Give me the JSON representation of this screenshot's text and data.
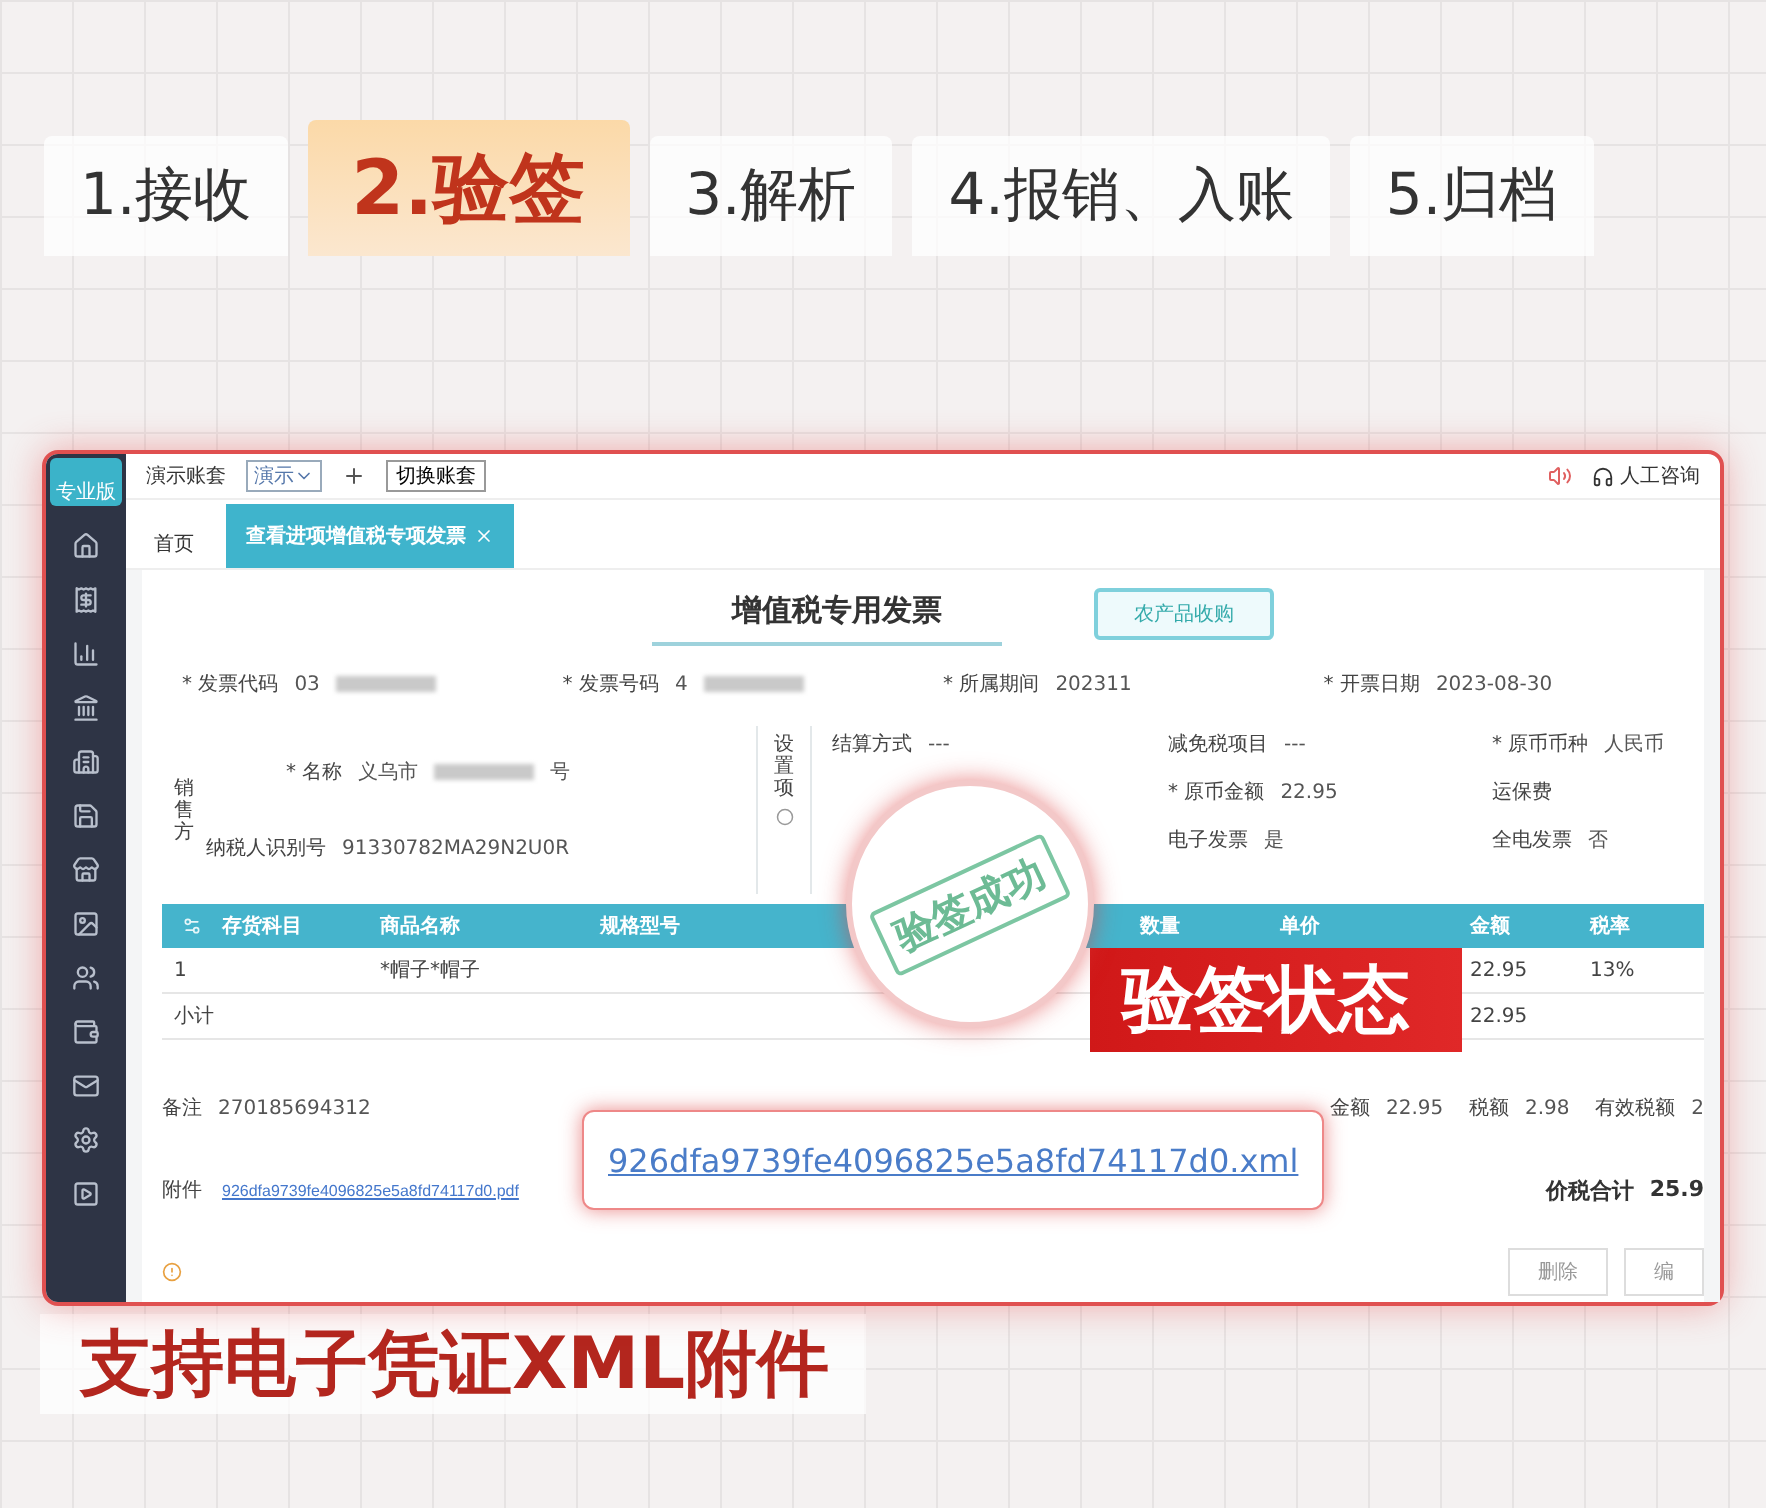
{
  "steps": [
    {
      "label": "1.接收",
      "selected": false
    },
    {
      "label": "2.验签",
      "selected": true
    },
    {
      "label": "3.解析",
      "selected": false
    },
    {
      "label": "4.报销、入账",
      "selected": false
    },
    {
      "label": "5.归档",
      "selected": false
    }
  ],
  "app": {
    "logo": "专业版",
    "account": "演示账套",
    "period_select": "演示",
    "switch_button": "切换账套",
    "support": "人工咨询",
    "tabs": [
      {
        "label": "首页",
        "selected": false,
        "closable": false
      },
      {
        "label": "查看进项增值税专项发票",
        "selected": true,
        "closable": true
      }
    ],
    "invoice": {
      "title": "增值税专用发票",
      "type_button": "农产品收购",
      "head_fields": [
        {
          "label": "* 发票代码",
          "value": "03",
          "masked": true
        },
        {
          "label": "* 发票号码",
          "value": "4",
          "masked": true
        },
        {
          "label": "* 所属期间",
          "value": "202311",
          "masked": false
        },
        {
          "label": "* 开票日期",
          "value": "2023-08-30",
          "masked": false
        }
      ],
      "seller": {
        "heading": "销售方",
        "name": {
          "label": "* 名称",
          "value": "义乌市",
          "suffix": "号"
        },
        "tax_id": {
          "label": "纳税人识别号",
          "value": "91330782MA29N2U0R"
        },
        "settings_label": "设置项"
      },
      "detail_fields": [
        {
          "label": "结算方式",
          "value": "---"
        },
        {
          "label": "减免税项目",
          "value": "---"
        },
        {
          "label": "* 原币币种",
          "value": "人民币"
        },
        {
          "label": "* 原币金额",
          "value": "22.95"
        },
        {
          "label": "运保费"
        },
        {
          "label": "电子发票",
          "value": "是"
        },
        {
          "label": "全电发票",
          "value": "否"
        }
      ],
      "table": {
        "columns": [
          "存货科目",
          "商品名称",
          "规格型号",
          "数量",
          "单价",
          "金额",
          "税率"
        ],
        "rows": [
          {
            "index": "1",
            "goods": "*帽子*帽子",
            "amount": "22.95",
            "rate": "13%"
          },
          {
            "index": "小计",
            "amount": "22.95"
          }
        ]
      },
      "remark": {
        "label": "备注",
        "value": "270185694312"
      },
      "attachment": {
        "label": "附件",
        "value": "926dfa9739fe4096825e5a8fd74117d0.pdf"
      },
      "totals": [
        {
          "label": "金额",
          "value": "22.95"
        },
        {
          "label": "税额",
          "value": "2.98"
        },
        {
          "label": "有效税额",
          "value": "2"
        }
      ],
      "grand_total": {
        "label": "价税合计",
        "value": "25.9"
      },
      "buttons": [
        "删除",
        "编"
      ]
    }
  },
  "overlays": {
    "stamp": "验签成功",
    "status_banner": "验签状态",
    "xml_callout": "926dfa9739fe4096825e5a8fd74117d0.xml"
  },
  "caption": "支持电子凭证XML附件"
}
